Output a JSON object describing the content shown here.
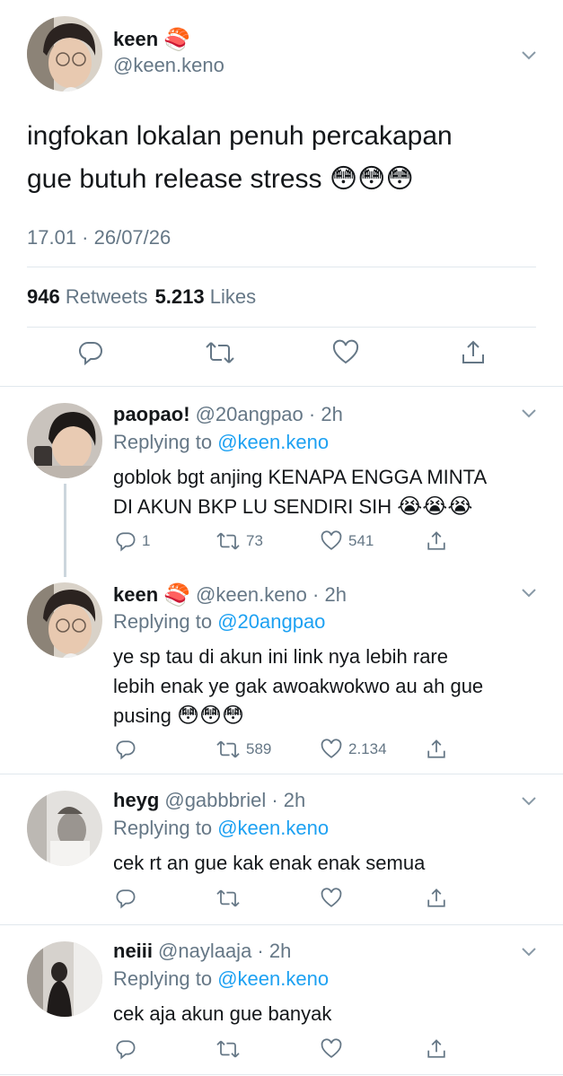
{
  "main_tweet": {
    "name": "keen",
    "name_emoji": "🍣",
    "handle": "@keen.keno",
    "text_line1": "ingfokan lokalan penuh percakapan",
    "text_line2": "gue butuh release stress",
    "text_emojis": "😳😳😳",
    "timestamp": "17.01 · 26/07/26",
    "retweets_count": "946",
    "retweets_label": "Retweets",
    "likes_count": "5.213",
    "likes_label": "Likes",
    "icons": [
      "reply-icon",
      "retweet-icon",
      "like-icon",
      "share-icon"
    ]
  },
  "replies": [
    {
      "name": "paopao!",
      "handle": "@20angpao · 2h",
      "replying_label": "Replying to",
      "replying_to": "@keen.keno",
      "line1": "goblok bgt anjing KENAPA ENGGA MINTA",
      "line2": "DI AKUN BKP LU SENDIRI SIH",
      "emojis": "😭😭😭",
      "reply_count": "1",
      "retweet_count": "73",
      "like_count": "541"
    },
    {
      "name": "keen",
      "name_emoji": "🍣",
      "handle": "@keen.keno · 2h",
      "replying_label": "Replying to",
      "replying_to": "@20angpao",
      "line1": "ye sp tau di akun ini link nya lebih rare",
      "line2": "lebih enak ye gak awoakwokwo au ah gue",
      "line3": "pusing",
      "emojis": "😳😳😳",
      "retweet_count": "589",
      "like_count": "2.134"
    },
    {
      "name": "heyg",
      "handle": "@gabbbriel · 2h",
      "replying_label": "Replying to",
      "replying_to": "@keen.keno",
      "line1": "cek rt an gue kak enak enak semua"
    },
    {
      "name": "neiii",
      "handle": "@naylaaja · 2h",
      "replying_label": "Replying to",
      "replying_to": "@keen.keno",
      "line1": "cek aja akun gue banyak"
    }
  ],
  "colors": {
    "text": "#14171a",
    "secondary": "#657786",
    "link": "#1da1f2",
    "divider": "#e1e8ed",
    "thread_line": "#ccd6dd"
  }
}
